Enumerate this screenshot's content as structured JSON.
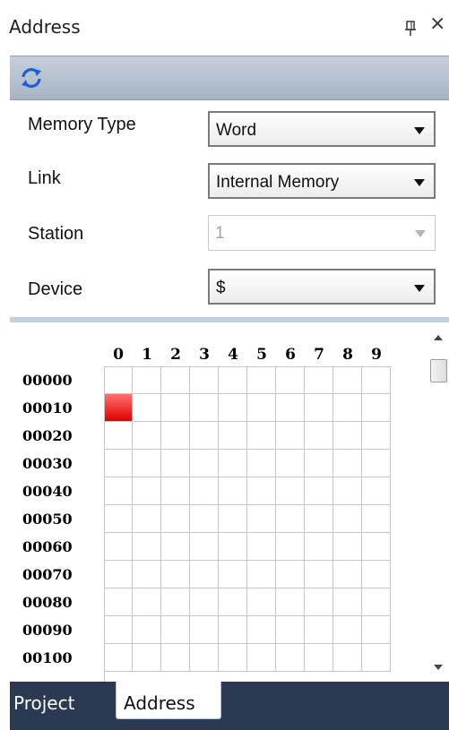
{
  "panel": {
    "title": "Address"
  },
  "toolbar": {
    "refresh_icon": "refresh-icon"
  },
  "fields": [
    {
      "label": "Memory Type",
      "value": "Word",
      "disabled": false
    },
    {
      "label": "Link",
      "value": "Internal Memory",
      "disabled": false
    },
    {
      "label": "Station",
      "value": "1",
      "disabled": true
    },
    {
      "label": "Device",
      "value": "$",
      "disabled": false
    }
  ],
  "grid": {
    "columns": [
      "0",
      "1",
      "2",
      "3",
      "4",
      "5",
      "6",
      "7",
      "8",
      "9"
    ],
    "rows": [
      "00000",
      "00010",
      "00020",
      "00030",
      "00040",
      "00050",
      "00060",
      "00070",
      "00080",
      "00090",
      "00100"
    ],
    "active_cells": [
      {
        "row": "00010",
        "col": "0"
      }
    ],
    "active_color": "#e00000"
  },
  "tabs": [
    {
      "label": "Project",
      "active": false
    },
    {
      "label": "Address",
      "active": true
    }
  ]
}
